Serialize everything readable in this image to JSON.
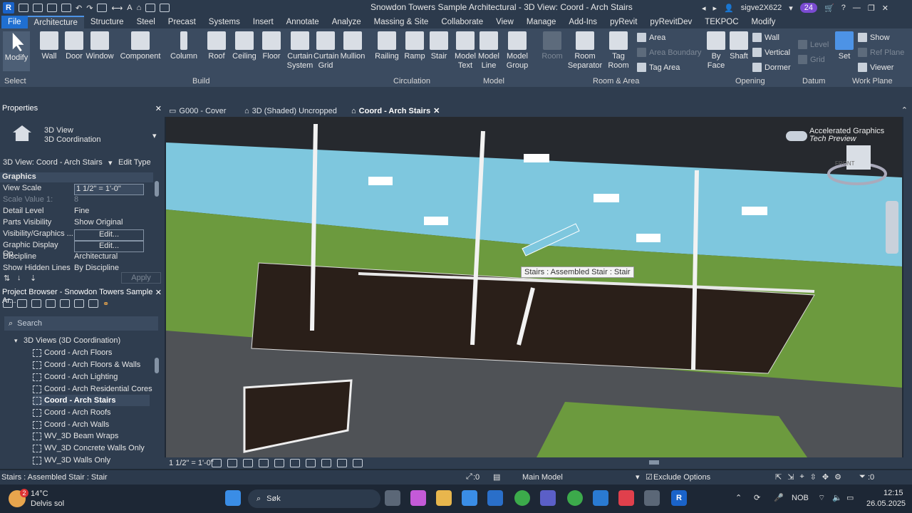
{
  "titlebar": {
    "title": "Snowdon Towers Sample Architectural - 3D View: Coord - Arch Stairs",
    "user": "sigve2X622",
    "badge": "24"
  },
  "menu": [
    "File",
    "Architecture",
    "Structure",
    "Steel",
    "Precast",
    "Systems",
    "Insert",
    "Annotate",
    "Analyze",
    "Massing & Site",
    "Collaborate",
    "View",
    "Manage",
    "Add-Ins",
    "pyRevit",
    "pyRevitDev",
    "TEKPOC",
    "Modify"
  ],
  "ribbon": {
    "buttons": [
      {
        "id": "modify",
        "l1": "Modify",
        "l2": ""
      },
      {
        "id": "wall",
        "l1": "Wall",
        "l2": ""
      },
      {
        "id": "door",
        "l1": "Door",
        "l2": ""
      },
      {
        "id": "window",
        "l1": "Window",
        "l2": ""
      },
      {
        "id": "component",
        "l1": "Component",
        "l2": ""
      },
      {
        "id": "column",
        "l1": "Column",
        "l2": ""
      },
      {
        "id": "roof",
        "l1": "Roof",
        "l2": ""
      },
      {
        "id": "ceiling",
        "l1": "Ceiling",
        "l2": ""
      },
      {
        "id": "floor",
        "l1": "Floor",
        "l2": ""
      },
      {
        "id": "curtainsys",
        "l1": "Curtain",
        "l2": "System"
      },
      {
        "id": "curtaingrid",
        "l1": "Curtain",
        "l2": "Grid"
      },
      {
        "id": "mullion",
        "l1": "Mullion",
        "l2": ""
      },
      {
        "id": "railing",
        "l1": "Railing",
        "l2": ""
      },
      {
        "id": "ramp",
        "l1": "Ramp",
        "l2": ""
      },
      {
        "id": "stair",
        "l1": "Stair",
        "l2": ""
      },
      {
        "id": "modeltext",
        "l1": "Model",
        "l2": "Text"
      },
      {
        "id": "modelline",
        "l1": "Model",
        "l2": "Line"
      },
      {
        "id": "modelgroup",
        "l1": "Model",
        "l2": "Group"
      },
      {
        "id": "room",
        "l1": "Room",
        "l2": ""
      },
      {
        "id": "roomsep",
        "l1": "Room",
        "l2": "Separator"
      },
      {
        "id": "tagroom",
        "l1": "Tag",
        "l2": "Room"
      },
      {
        "id": "byface",
        "l1": "By",
        "l2": "Face"
      },
      {
        "id": "shaft",
        "l1": "Shaft",
        "l2": ""
      },
      {
        "id": "set",
        "l1": "Set",
        "l2": ""
      }
    ],
    "small": {
      "area": "Area",
      "area_boundary": "Area Boundary",
      "tag_area": "Tag Area",
      "wall": "Wall",
      "vertical": "Vertical",
      "dormer": "Dormer",
      "level": "Level",
      "grid": "Grid",
      "show": "Show",
      "ref_plane": "Ref Plane",
      "viewer": "Viewer"
    },
    "panels": {
      "select": "Select",
      "build": "Build",
      "circulation": "Circulation",
      "model": "Model",
      "room": "Room & Area",
      "opening": "Opening",
      "datum": "Datum",
      "workplane": "Work Plane"
    }
  },
  "properties": {
    "header": "Properties",
    "type1": "3D View",
    "type2": "3D Coordination",
    "selector": "3D View: Coord - Arch Stairs",
    "edit_type": "Edit Type",
    "section": "Graphics",
    "apply": "Apply",
    "rows": [
      {
        "k": "View Scale",
        "v": "1 1/2\" = 1'-0\""
      },
      {
        "k": "Scale Value    1:",
        "v": "8"
      },
      {
        "k": "Detail Level",
        "v": "Fine"
      },
      {
        "k": "Parts Visibility",
        "v": "Show Original"
      },
      {
        "k": "Visibility/Graphics ...",
        "v": "Edit..."
      },
      {
        "k": "Graphic Display Op...",
        "v": "Edit..."
      },
      {
        "k": "Discipline",
        "v": "Architectural"
      },
      {
        "k": "Show Hidden Lines",
        "v": "By Discipline"
      }
    ]
  },
  "browser": {
    "header": "Project Browser - Snowdon Towers Sample Ar...",
    "search": "Search",
    "group": "3D Views (3D Coordination)",
    "items": [
      "Coord - Arch Floors",
      "Coord - Arch Floors & Walls",
      "Coord - Arch Lighting",
      "Coord - Arch Residential Cores",
      "Coord - Arch Stairs",
      "Coord - Arch Roofs",
      "Coord - Arch Walls",
      "WV_3D Beam Wraps",
      "WV_3D Concrete Walls Only",
      "WV_3D Walls Only"
    ]
  },
  "tabs": [
    "G000 - Cover",
    "3D (Shaded) Uncropped",
    "Coord - Arch Stairs"
  ],
  "view": {
    "accel": "Accelerated Graphics",
    "tech": "Tech Preview",
    "cube": "FRONT",
    "tooltip": "Stairs : Assembled Stair : Stair"
  },
  "viewbar": {
    "scale": "1 1/2\" = 1'-0\""
  },
  "status": {
    "left": "Stairs : Assembled Stair : Stair",
    "zero1": ":0",
    "model": "Main Model",
    "exclude": "Exclude Options",
    "zero2": ":0"
  },
  "taskbar": {
    "temp": "14°C",
    "weather": "Delvis sol",
    "search": "Søk",
    "lang": "NOB",
    "time": "12:15",
    "date": "26.05.2025",
    "notif": "2"
  }
}
